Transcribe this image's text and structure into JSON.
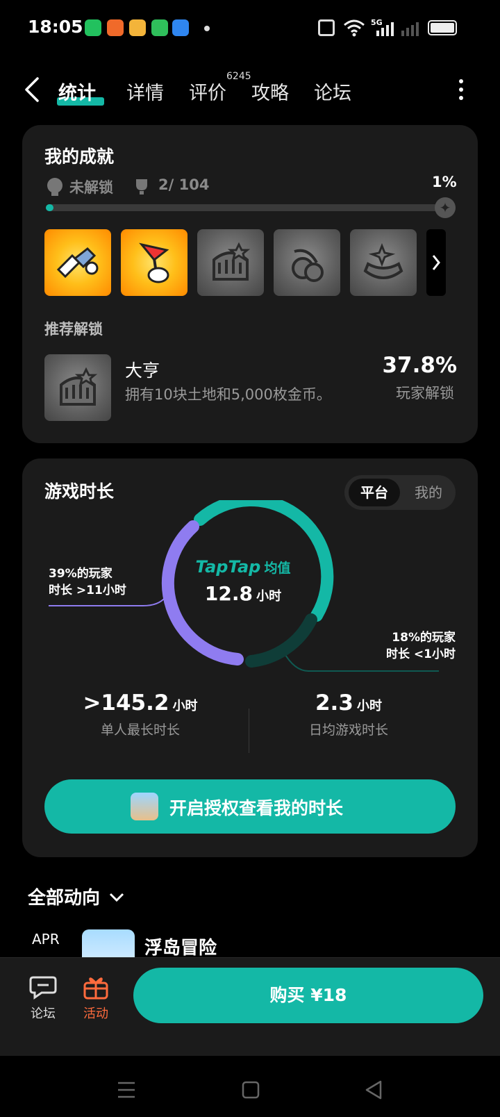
{
  "status_bar": {
    "time": "18:05",
    "network": "5G"
  },
  "nav": {
    "tabs": [
      {
        "label": "统计"
      },
      {
        "label": "详情"
      },
      {
        "label": "评价"
      },
      {
        "label": "攻略"
      },
      {
        "label": "论坛"
      }
    ],
    "review_count": "6245"
  },
  "achievements": {
    "title": "我的成就",
    "locked_label": "未解锁",
    "progress_text": "2/ 104",
    "percent": "1%",
    "progress_fraction": 0.02,
    "recommend_title": "推荐解锁",
    "recommended": {
      "name": "大亨",
      "desc": "拥有10块土地和5,000枚金币。",
      "rate": "37.8%",
      "rate_label": "玩家解锁"
    }
  },
  "playtime": {
    "title": "游戏时长",
    "toggle": {
      "platform": "平台",
      "mine": "我的"
    },
    "center_brand": "TapTap",
    "center_label": "均值",
    "center_value": "12.8",
    "center_unit": "小时",
    "left_note_1": "39%的玩家",
    "left_note_2": "时长 >11小时",
    "right_note_1": "18%的玩家",
    "right_note_2": "时长 <1小时",
    "stat1_value": ">145.2",
    "stat1_unit": "小时",
    "stat1_label": "单人最长时长",
    "stat2_value": "2.3",
    "stat2_unit": "小时",
    "stat2_label": "日均游戏时长",
    "auth_button": "开启授权查看我的时长",
    "colors": {
      "teal": "#14b8a6",
      "purple": "#8f7cf0",
      "dark_teal": "#0f3d38"
    }
  },
  "feed": {
    "title": "全部动向",
    "month": "APR",
    "item_title": "浮岛冒险"
  },
  "bottom": {
    "forum_label": "论坛",
    "activity_label": "活动",
    "buy_button": "购买 ¥18"
  }
}
